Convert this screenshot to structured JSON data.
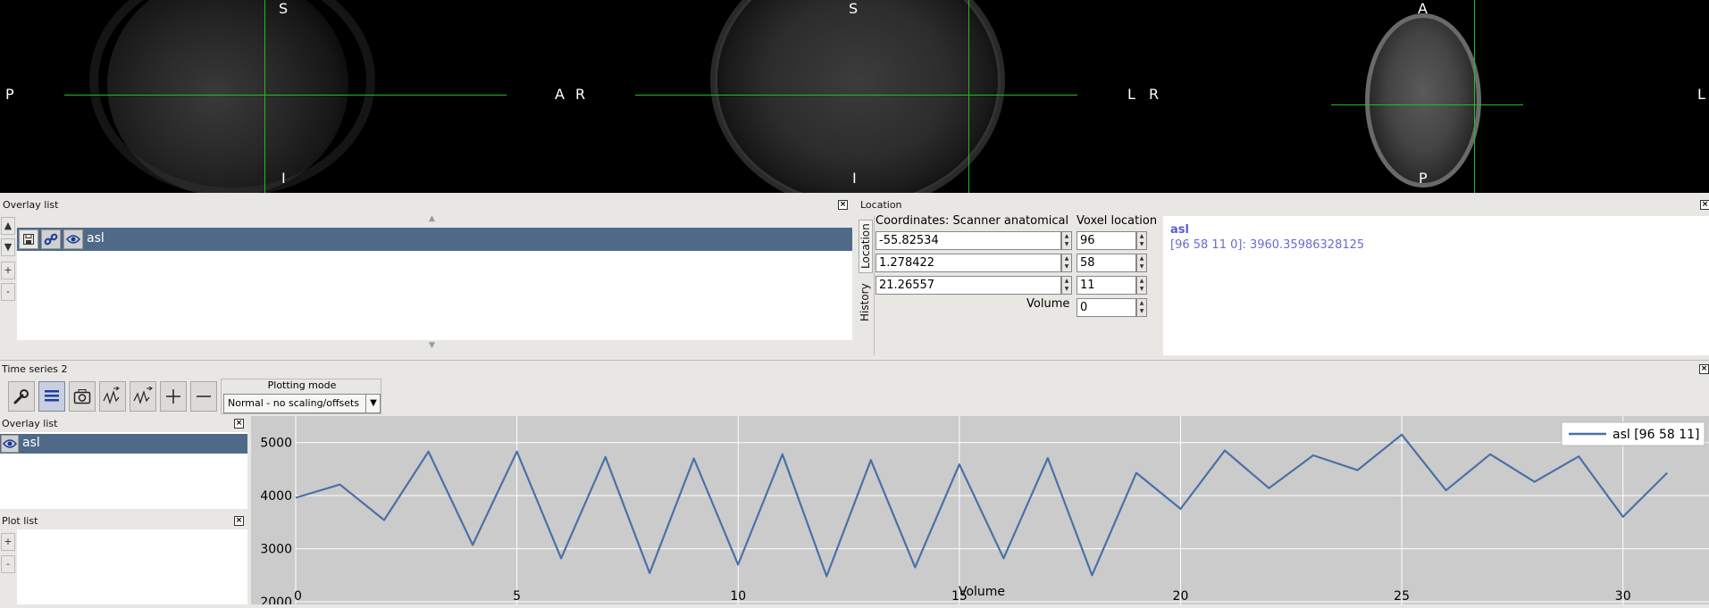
{
  "ortho": {
    "sagittal": {
      "top": "S",
      "bottom": "I",
      "left": "P",
      "right": "A"
    },
    "coronal": {
      "top": "S",
      "bottom": "I",
      "left": "R",
      "right": "L"
    },
    "axial": {
      "top": "A",
      "bottom": "P",
      "left": "R",
      "right": "L"
    }
  },
  "overlay_panel": {
    "title": "Overlay list",
    "items": [
      {
        "name": "asl"
      }
    ]
  },
  "location_panel": {
    "title": "Location",
    "tabs": [
      "Location",
      "History"
    ],
    "coord_label": "Coordinates: Scanner anatomical",
    "voxel_label": "Voxel location",
    "coords": [
      "-55.82534",
      "1.278422",
      "21.26557"
    ],
    "voxels": [
      "96",
      "58",
      "11"
    ],
    "volume_label": "Volume",
    "volume": "0",
    "info_name": "asl",
    "info_value": "[96 58 11 0]: 3960.35986328125"
  },
  "timeseries": {
    "title": "Time series 2",
    "plotting_mode_label": "Plotting mode",
    "plotting_mode": "Normal - no scaling/offsets",
    "overlay_list_title": "Overlay list",
    "overlay_items": [
      {
        "name": "asl"
      }
    ],
    "plot_list_title": "Plot list"
  },
  "chart_data": {
    "type": "line",
    "xlabel": "Volume",
    "ylabel": "",
    "xlim": [
      0,
      31.5
    ],
    "ylim": [
      2000,
      5500
    ],
    "xticks": [
      0,
      5,
      10,
      15,
      20,
      25,
      30
    ],
    "yticks": [
      2000,
      3000,
      4000,
      5000
    ],
    "grid": true,
    "legend_position": "top-right",
    "background": "#cbcbcb",
    "series": [
      {
        "name": "asl [96 58 11]",
        "color": "#4a71a6",
        "x": [
          0,
          1,
          2,
          3,
          4,
          5,
          6,
          7,
          8,
          9,
          10,
          11,
          12,
          13,
          14,
          15,
          16,
          17,
          18,
          19,
          20,
          21,
          22,
          23,
          24,
          25,
          26,
          27,
          28,
          29,
          30,
          31
        ],
        "values": [
          3960,
          4210,
          3540,
          4830,
          3070,
          4830,
          2820,
          4730,
          2540,
          4700,
          2700,
          4780,
          2480,
          4670,
          2650,
          4590,
          2820,
          4710,
          2500,
          4430,
          3750,
          4850,
          4140,
          4760,
          4480,
          5150,
          4100,
          4780,
          4260,
          4740,
          3600,
          4430
        ]
      }
    ]
  }
}
